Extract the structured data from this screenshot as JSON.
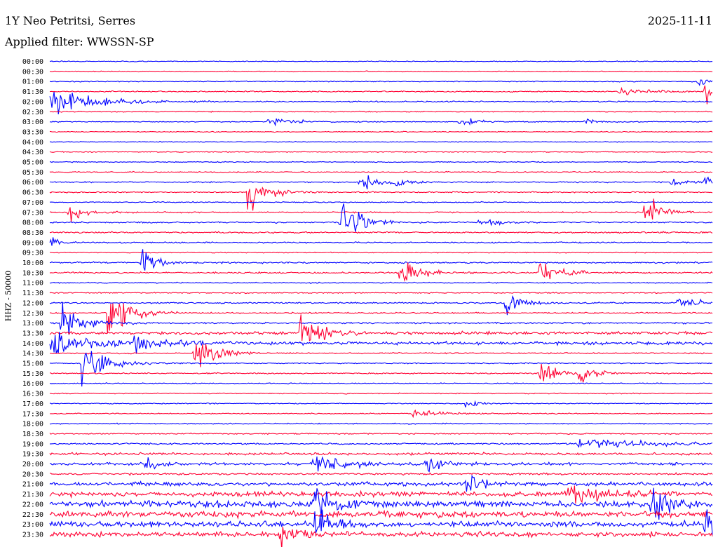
{
  "header": {
    "station": "1Y Neo Petritsi, Serres",
    "date": "2025-11-11",
    "filter": "Applied filter: WWSSN-SP"
  },
  "channel_label": "HHZ - 50000",
  "colors": {
    "even_trace": "#0000ff",
    "odd_trace": "#ff0033",
    "background": "#ffffff"
  },
  "chart_data": {
    "type": "line",
    "subtype": "helicorder",
    "date": "2025-11-11",
    "ylabel": "HHZ - 50000",
    "row_labels": [
      "00:00",
      "00:30",
      "01:00",
      "01:30",
      "02:00",
      "02:30",
      "03:00",
      "03:30",
      "04:00",
      "04:30",
      "05:00",
      "05:30",
      "06:00",
      "06:30",
      "07:00",
      "07:30",
      "08:00",
      "08:30",
      "09:00",
      "09:30",
      "10:00",
      "10:30",
      "11:00",
      "11:30",
      "12:00",
      "12:30",
      "13:00",
      "13:30",
      "14:00",
      "14:30",
      "15:00",
      "15:30",
      "16:00",
      "16:30",
      "17:00",
      "17:30",
      "18:00",
      "18:30",
      "19:00",
      "19:30",
      "20:00",
      "20:30",
      "21:00",
      "21:30",
      "22:00",
      "22:30",
      "23:00",
      "23:30"
    ],
    "row_minutes": 30,
    "color_cycle": [
      "blue",
      "red"
    ],
    "noise_level": [
      1,
      1,
      1.2,
      1.5,
      1.5,
      1.2,
      1.1,
      1.0,
      1.0,
      1.1,
      1.1,
      1.2,
      1.4,
      1.4,
      1.2,
      1.6,
      1.6,
      1.8,
      1.5,
      1.2,
      1.8,
      1.8,
      1.3,
      1.4,
      1.6,
      1.6,
      1.8,
      3.5,
      3.8,
      1.6,
      1.4,
      1.4,
      1.2,
      1.2,
      1.2,
      1.2,
      1.4,
      1.4,
      1.8,
      2.8,
      3.2,
      2.2,
      4.5,
      5.5,
      7.5,
      7.0,
      6.5,
      5.5
    ],
    "events": [
      {
        "row": 2,
        "t": 0.98,
        "amp": 8,
        "dur": 0.02
      },
      {
        "row": 3,
        "t": 0.86,
        "amp": 5,
        "dur": 0.06
      },
      {
        "row": 3,
        "t": 0.99,
        "amp": 20,
        "dur": 0.02
      },
      {
        "row": 4,
        "t": 0.0,
        "amp": 18,
        "dur": 0.09
      },
      {
        "row": 6,
        "t": 0.33,
        "amp": 5,
        "dur": 0.07
      },
      {
        "row": 6,
        "t": 0.62,
        "amp": 8,
        "dur": 0.03
      },
      {
        "row": 6,
        "t": 0.81,
        "amp": 4,
        "dur": 0.02
      },
      {
        "row": 12,
        "t": 0.47,
        "amp": 14,
        "dur": 0.03
      },
      {
        "row": 12,
        "t": 0.52,
        "amp": 8,
        "dur": 0.03
      },
      {
        "row": 12,
        "t": 0.94,
        "amp": 7,
        "dur": 0.03
      },
      {
        "row": 12,
        "t": 0.99,
        "amp": 14,
        "dur": 0.02
      },
      {
        "row": 13,
        "t": 0.3,
        "amp": 28,
        "dur": 0.04
      },
      {
        "row": 15,
        "t": 0.03,
        "amp": 12,
        "dur": 0.03
      },
      {
        "row": 15,
        "t": 0.9,
        "amp": 22,
        "dur": 0.03
      },
      {
        "row": 16,
        "t": 0.44,
        "amp": 38,
        "dur": 0.04
      },
      {
        "row": 16,
        "t": 0.65,
        "amp": 6,
        "dur": 0.05
      },
      {
        "row": 18,
        "t": 0.0,
        "amp": 8,
        "dur": 0.02
      },
      {
        "row": 20,
        "t": 0.14,
        "amp": 22,
        "dur": 0.03
      },
      {
        "row": 21,
        "t": 0.53,
        "amp": 20,
        "dur": 0.04
      },
      {
        "row": 21,
        "t": 0.74,
        "amp": 18,
        "dur": 0.04
      },
      {
        "row": 24,
        "t": 0.69,
        "amp": 18,
        "dur": 0.03
      },
      {
        "row": 24,
        "t": 0.95,
        "amp": 7,
        "dur": 0.05
      },
      {
        "row": 25,
        "t": 0.09,
        "amp": 40,
        "dur": 0.04
      },
      {
        "row": 26,
        "t": 0.02,
        "amp": 30,
        "dur": 0.04
      },
      {
        "row": 27,
        "t": 0.38,
        "amp": 26,
        "dur": 0.04
      },
      {
        "row": 28,
        "t": 0.0,
        "amp": 14,
        "dur": 0.1
      },
      {
        "row": 28,
        "t": 0.13,
        "amp": 12,
        "dur": 0.05
      },
      {
        "row": 29,
        "t": 0.22,
        "amp": 30,
        "dur": 0.04
      },
      {
        "row": 30,
        "t": 0.05,
        "amp": 26,
        "dur": 0.05
      },
      {
        "row": 31,
        "t": 0.74,
        "amp": 20,
        "dur": 0.03
      },
      {
        "row": 31,
        "t": 0.8,
        "amp": 22,
        "dur": 0.03
      },
      {
        "row": 34,
        "t": 0.63,
        "amp": 6,
        "dur": 0.03
      },
      {
        "row": 35,
        "t": 0.55,
        "amp": 6,
        "dur": 0.05
      },
      {
        "row": 38,
        "t": 0.8,
        "amp": 6,
        "dur": 0.2
      },
      {
        "row": 40,
        "t": 0.14,
        "amp": 14,
        "dur": 0.03
      },
      {
        "row": 40,
        "t": 0.4,
        "amp": 14,
        "dur": 0.07
      },
      {
        "row": 40,
        "t": 0.57,
        "amp": 12,
        "dur": 0.03
      },
      {
        "row": 42,
        "t": 0.63,
        "amp": 14,
        "dur": 0.03
      },
      {
        "row": 43,
        "t": 0.78,
        "amp": 16,
        "dur": 0.06
      },
      {
        "row": 44,
        "t": 0.4,
        "amp": 20,
        "dur": 0.04
      },
      {
        "row": 44,
        "t": 0.91,
        "amp": 22,
        "dur": 0.04
      },
      {
        "row": 46,
        "t": 0.4,
        "amp": 24,
        "dur": 0.03
      },
      {
        "row": 46,
        "t": 0.99,
        "amp": 20,
        "dur": 0.02
      },
      {
        "row": 47,
        "t": 0.35,
        "amp": 16,
        "dur": 0.03
      }
    ]
  }
}
